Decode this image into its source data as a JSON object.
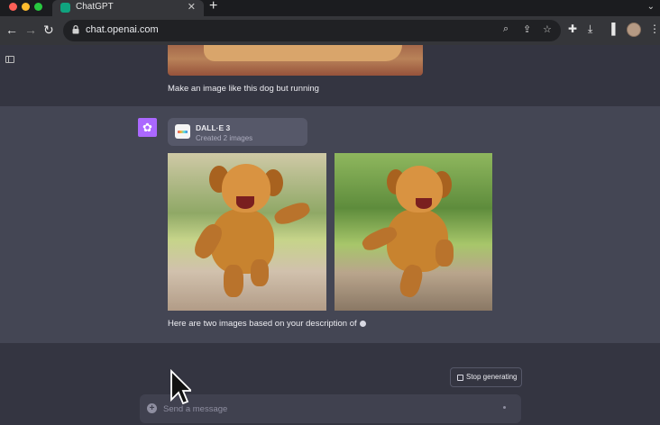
{
  "browser": {
    "tab_title": "ChatGPT",
    "tab_close": "✕",
    "new_tab": "+",
    "url": "chat.openai.com",
    "icons": [
      "back-icon",
      "forward-icon",
      "reload-icon",
      "lock-icon",
      "zoom-icon",
      "share-icon",
      "star-icon",
      "extensions-icon",
      "download-icon",
      "sidebar-icon",
      "menu-icon"
    ]
  },
  "conversation": {
    "user_message": "Make an image like this dog but running",
    "tool_card": {
      "title": "DALL·E 3",
      "subtitle": "Created 2 images"
    },
    "assistant_text": "Here are two images based on your description of"
  },
  "controls": {
    "stop_label": "Stop generating"
  },
  "composer": {
    "placeholder": "Send a message"
  },
  "colors": {
    "page_bg": "#343541",
    "assistant_bg": "#444654",
    "gpt_avatar": "#ab68ff",
    "composer_bg": "#40414f"
  }
}
